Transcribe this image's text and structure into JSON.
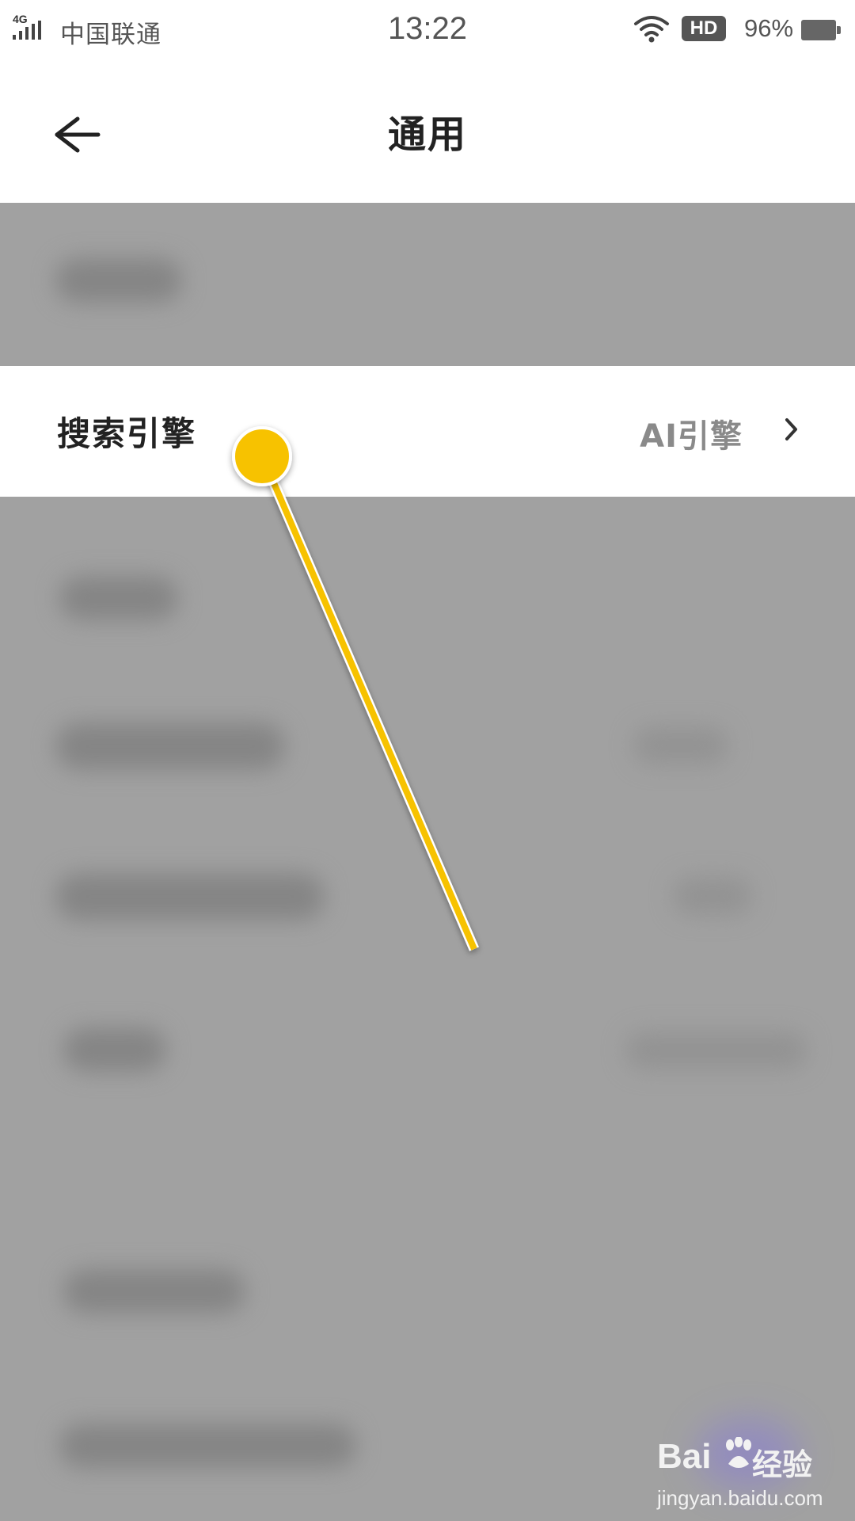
{
  "status_bar": {
    "network": "4G",
    "carrier": "中国联通",
    "time": "13:22",
    "hd": "HD",
    "battery": "96%",
    "icons": [
      "signal-icon",
      "wifi-icon",
      "battery-icon"
    ]
  },
  "header": {
    "back_icon": "arrow-left-icon",
    "title": "通用"
  },
  "settings": {
    "highlighted_row": {
      "label": "搜索引擎",
      "value": "AI引擎",
      "icon": "chevron-right-icon"
    }
  },
  "annotation": {
    "color": "#F7C200"
  },
  "watermark": {
    "brand": "Bai",
    "brand_cn": "经验",
    "domain": "jingyan.baidu.com"
  },
  "colors": {
    "dim_overlay": "#A1A1A1",
    "title_text": "#222222",
    "value_text": "#8A8A8A"
  }
}
